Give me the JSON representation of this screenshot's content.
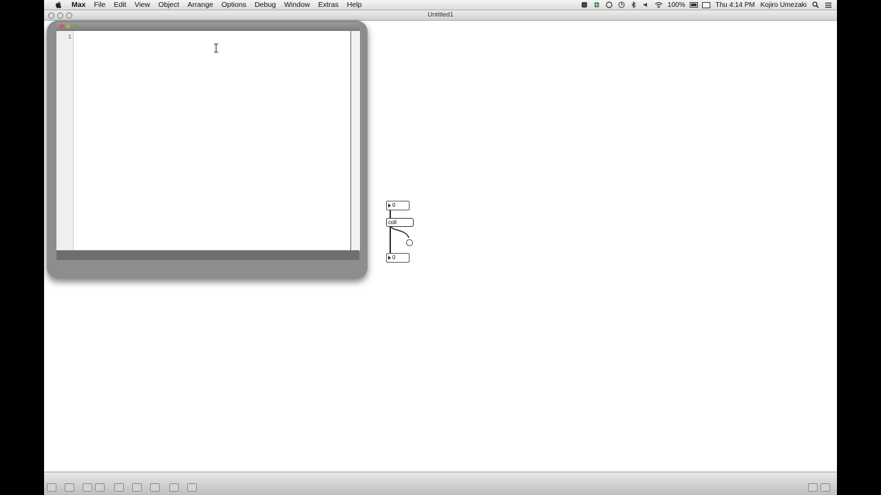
{
  "menubar": {
    "app_name": "Max",
    "items": [
      "File",
      "Edit",
      "View",
      "Object",
      "Arrange",
      "Options",
      "Debug",
      "Window",
      "Extras",
      "Help"
    ],
    "battery": "100%",
    "clock": "Thu 4:14 PM",
    "user": "Kojiro Umezaki"
  },
  "window": {
    "title": "Untitled1"
  },
  "editor": {
    "line_numbers": [
      "1"
    ]
  },
  "patch": {
    "number_top": "0",
    "object_label": "coll",
    "number_bottom": "0"
  }
}
